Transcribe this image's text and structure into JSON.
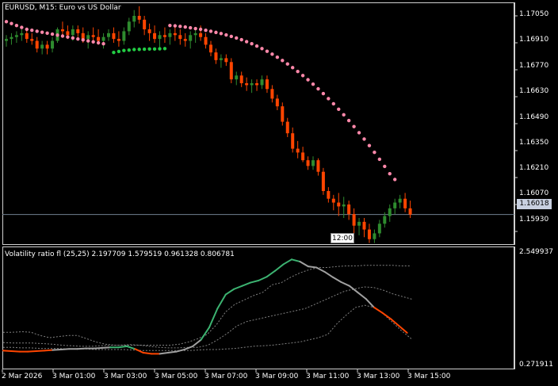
{
  "window": {
    "main_title": "EURUSD, M15:  Euro vs US Dollar",
    "indicator_title": "Volatility ratio fl (25,25) 2.197709 1.579519 0.961328 0.806781"
  },
  "price_axis": {
    "labels": [
      "1.17050",
      "1.16910",
      "1.16770",
      "1.16630",
      "1.16490",
      "1.16350",
      "1.16210",
      "1.16070",
      "1.15930"
    ],
    "current_price": "1.16018"
  },
  "indicator_axis": {
    "labels": [
      "2.549937",
      "0.271911"
    ]
  },
  "time_axis": {
    "labels": [
      "2 Mar 2026",
      "3 Mar 01:00",
      "3 Mar 03:00",
      "3 Mar 05:00",
      "3 Mar 07:00",
      "3 Mar 09:00",
      "3 Mar 11:00",
      "3 Mar 13:00",
      "3 Mar 15:00"
    ],
    "cursor_label": "12:00"
  },
  "colors": {
    "background": "#000000",
    "bull": "#2e8b2e",
    "bear": "#ff4500",
    "sar_above": "#ff88aa",
    "sar_below": "#22cc44",
    "vr_up": "#3cb371",
    "vr_neutral": "#a0a0a0",
    "vr_down": "#ff4500",
    "grid_line": "#c0c0c0",
    "current_line": "#708090"
  },
  "chart_data": {
    "type": "candlestick",
    "symbol": "EURUSD",
    "timeframe": "M15",
    "y_range": [
      1.1586,
      1.1712
    ],
    "candles": [
      [
        1.1692,
        1.1695,
        1.1689,
        1.1693
      ],
      [
        1.1693,
        1.1696,
        1.169,
        1.1694
      ],
      [
        1.1694,
        1.1697,
        1.1691,
        1.1695
      ],
      [
        1.1695,
        1.1698,
        1.1692,
        1.1696
      ],
      [
        1.1696,
        1.1698,
        1.1691,
        1.1693
      ],
      [
        1.1693,
        1.1696,
        1.169,
        1.1692
      ],
      [
        1.1692,
        1.1694,
        1.1686,
        1.1688
      ],
      [
        1.1688,
        1.1692,
        1.1685,
        1.169
      ],
      [
        1.169,
        1.1692,
        1.1685,
        1.1688
      ],
      [
        1.1688,
        1.1694,
        1.1686,
        1.1692
      ],
      [
        1.1692,
        1.1699,
        1.1691,
        1.1698
      ],
      [
        1.1698,
        1.1702,
        1.1695,
        1.1697
      ],
      [
        1.1697,
        1.17,
        1.1693,
        1.1695
      ],
      [
        1.1695,
        1.17,
        1.1692,
        1.1698
      ],
      [
        1.1698,
        1.17,
        1.1694,
        1.1696
      ],
      [
        1.1696,
        1.1699,
        1.1691,
        1.1693
      ],
      [
        1.1693,
        1.1697,
        1.1688,
        1.1695
      ],
      [
        1.1695,
        1.1699,
        1.1691,
        1.1694
      ],
      [
        1.1694,
        1.1698,
        1.169,
        1.1692
      ],
      [
        1.1692,
        1.1696,
        1.1688,
        1.1694
      ],
      [
        1.1694,
        1.1698,
        1.1692,
        1.1696
      ],
      [
        1.1696,
        1.1699,
        1.1691,
        1.1693
      ],
      [
        1.1693,
        1.1697,
        1.1689,
        1.1692
      ],
      [
        1.1692,
        1.1699,
        1.169,
        1.1697
      ],
      [
        1.1697,
        1.1704,
        1.1695,
        1.1702
      ],
      [
        1.1702,
        1.1708,
        1.1699,
        1.1705
      ],
      [
        1.1705,
        1.171,
        1.1701,
        1.1703
      ],
      [
        1.1703,
        1.1705,
        1.1695,
        1.1698
      ],
      [
        1.1698,
        1.1701,
        1.1692,
        1.1696
      ],
      [
        1.1696,
        1.17,
        1.1691,
        1.1693
      ],
      [
        1.1693,
        1.1697,
        1.1688,
        1.1695
      ],
      [
        1.1695,
        1.1699,
        1.1691,
        1.1694
      ],
      [
        1.1694,
        1.1698,
        1.169,
        1.1696
      ],
      [
        1.1696,
        1.1699,
        1.1692,
        1.1695
      ],
      [
        1.1695,
        1.1698,
        1.169,
        1.1693
      ],
      [
        1.1693,
        1.1696,
        1.1689,
        1.1692
      ],
      [
        1.1692,
        1.1697,
        1.1688,
        1.1695
      ],
      [
        1.1695,
        1.1699,
        1.1691,
        1.1696
      ],
      [
        1.1696,
        1.17,
        1.1692,
        1.1694
      ],
      [
        1.1694,
        1.1696,
        1.1688,
        1.169
      ],
      [
        1.169,
        1.1692,
        1.1684,
        1.1686
      ],
      [
        1.1686,
        1.1688,
        1.168,
        1.1682
      ],
      [
        1.1682,
        1.1685,
        1.1678,
        1.1683
      ],
      [
        1.1683,
        1.1685,
        1.1679,
        1.1681
      ],
      [
        1.1681,
        1.1683,
        1.167,
        1.1672
      ],
      [
        1.1672,
        1.1676,
        1.1669,
        1.1674
      ],
      [
        1.1674,
        1.1676,
        1.1668,
        1.167
      ],
      [
        1.167,
        1.1673,
        1.1666,
        1.1669
      ],
      [
        1.1669,
        1.1672,
        1.1665,
        1.167
      ],
      [
        1.167,
        1.1672,
        1.1666,
        1.1669
      ],
      [
        1.1669,
        1.1674,
        1.1667,
        1.1672
      ],
      [
        1.1672,
        1.1674,
        1.1665,
        1.1667
      ],
      [
        1.1667,
        1.1669,
        1.166,
        1.1662
      ],
      [
        1.1662,
        1.1664,
        1.1656,
        1.1658
      ],
      [
        1.1658,
        1.166,
        1.1648,
        1.165
      ],
      [
        1.165,
        1.1652,
        1.1642,
        1.1644
      ],
      [
        1.1644,
        1.1647,
        1.1634,
        1.1636
      ],
      [
        1.1636,
        1.164,
        1.1631,
        1.1634
      ],
      [
        1.1634,
        1.1637,
        1.1629,
        1.163
      ],
      [
        1.163,
        1.1632,
        1.1625,
        1.1627
      ],
      [
        1.1627,
        1.1632,
        1.1625,
        1.163
      ],
      [
        1.163,
        1.1631,
        1.1622,
        1.1624
      ],
      [
        1.1624,
        1.1626,
        1.1612,
        1.1614
      ],
      [
        1.1614,
        1.1616,
        1.1608,
        1.161
      ],
      [
        1.161,
        1.1612,
        1.1604,
        1.1608
      ],
      [
        1.1608,
        1.1613,
        1.1601,
        1.1606
      ],
      [
        1.1606,
        1.1611,
        1.16,
        1.1607
      ],
      [
        1.1607,
        1.1609,
        1.1599,
        1.1602
      ],
      [
        1.1602,
        1.1605,
        1.1592,
        1.1596
      ],
      [
        1.1596,
        1.16,
        1.1591,
        1.1598
      ],
      [
        1.1598,
        1.16,
        1.159,
        1.1594
      ],
      [
        1.1594,
        1.1597,
        1.1587,
        1.1589
      ],
      [
        1.1589,
        1.1594,
        1.1587,
        1.1592
      ],
      [
        1.1592,
        1.1599,
        1.159,
        1.1597
      ],
      [
        1.1597,
        1.1603,
        1.1595,
        1.1601
      ],
      [
        1.1601,
        1.1607,
        1.1598,
        1.1605
      ],
      [
        1.1605,
        1.161,
        1.1602,
        1.1608
      ],
      [
        1.1608,
        1.1612,
        1.1605,
        1.161
      ],
      [
        1.161,
        1.1613,
        1.1603,
        1.1605
      ],
      [
        1.1605,
        1.1609,
        1.16,
        1.16018
      ]
    ],
    "sar": {
      "below_segment_values": [
        1.1686,
        1.16865,
        1.1687,
        1.16872,
        1.16875,
        1.16876,
        1.16877,
        1.16878,
        1.16878,
        1.16879,
        1.1688
      ],
      "above_segment_1_values": [
        1.1702,
        1.1701,
        1.17,
        1.1699,
        1.1698,
        1.16975,
        1.1697,
        1.16965,
        1.1696,
        1.16955,
        1.1695,
        1.16945,
        1.1694,
        1.16935,
        1.1693,
        1.16925,
        1.1692,
        1.16915,
        1.1691,
        1.16905
      ],
      "above_segment_2_values": [
        1.17,
        1.16998,
        1.16995,
        1.16992,
        1.16988,
        1.16984,
        1.1698,
        1.16975,
        1.1697,
        1.16964,
        1.16958,
        1.16951,
        1.16943,
        1.16935,
        1.16926,
        1.16916,
        1.16905,
        1.16893,
        1.1688,
        1.16866,
        1.16851,
        1.16835,
        1.16818,
        1.168,
        1.16781,
        1.16761,
        1.1674,
        1.16718,
        1.16695,
        1.16671,
        1.16646,
        1.1662,
        1.16593,
        1.16565,
        1.16536,
        1.16506,
        1.16475,
        1.16443,
        1.1641,
        1.16376,
        1.16341,
        1.16305,
        1.16268,
        1.1623,
        1.162
      ]
    },
    "volatility_ratio": {
      "y_range": [
        0.271911,
        2.549937
      ],
      "main": [
        0.62,
        0.61,
        0.6,
        0.6,
        0.61,
        0.62,
        0.63,
        0.64,
        0.65,
        0.65,
        0.66,
        0.66,
        0.67,
        0.68,
        0.68,
        0.7,
        0.65,
        0.58,
        0.56,
        0.56,
        0.58,
        0.6,
        0.64,
        0.7,
        0.82,
        1.05,
        1.4,
        1.66,
        1.76,
        1.82,
        1.88,
        1.92,
        1.99,
        2.1,
        2.22,
        2.31,
        2.27,
        2.18,
        2.16,
        2.08,
        1.98,
        1.89,
        1.82,
        1.7,
        1.58,
        1.42,
        1.32,
        1.21,
        1.08,
        0.95
      ],
      "upper": [
        0.96,
        0.96,
        0.97,
        0.96,
        0.9,
        0.86,
        0.88,
        0.9,
        0.9,
        0.84,
        0.78,
        0.74,
        0.72,
        0.72,
        0.72,
        0.72,
        0.72,
        0.72,
        0.72,
        0.74,
        0.78,
        0.84,
        0.92,
        1.1,
        1.34,
        1.48,
        1.56,
        1.64,
        1.7,
        1.84,
        1.88,
        1.98,
        2.06,
        2.12,
        2.16,
        2.16,
        2.18,
        2.19,
        2.19,
        2.2,
        2.2,
        2.2,
        2.2,
        2.19,
        2.19
      ],
      "middle": [
        0.77,
        0.76,
        0.76,
        0.76,
        0.75,
        0.74,
        0.72,
        0.71,
        0.7,
        0.7,
        0.71,
        0.72,
        0.72,
        0.73,
        0.72,
        0.7,
        0.68,
        0.67,
        0.67,
        0.68,
        0.68,
        0.72,
        0.82,
        0.94,
        1.08,
        1.16,
        1.2,
        1.24,
        1.28,
        1.32,
        1.36,
        1.4,
        1.48,
        1.56,
        1.64,
        1.72,
        1.76,
        1.8,
        1.79,
        1.74,
        1.67,
        1.62,
        1.57
      ],
      "lower": [
        0.68,
        0.68,
        0.67,
        0.67,
        0.66,
        0.66,
        0.66,
        0.65,
        0.65,
        0.65,
        0.64,
        0.64,
        0.64,
        0.64,
        0.63,
        0.62,
        0.62,
        0.62,
        0.62,
        0.62,
        0.62,
        0.63,
        0.64,
        0.64,
        0.65,
        0.66,
        0.68,
        0.7,
        0.71,
        0.72,
        0.74,
        0.76,
        0.78,
        0.82,
        0.86,
        0.92,
        1.12,
        1.28,
        1.42,
        1.46,
        1.42,
        1.3,
        1.14,
        0.98,
        0.84
      ]
    }
  }
}
